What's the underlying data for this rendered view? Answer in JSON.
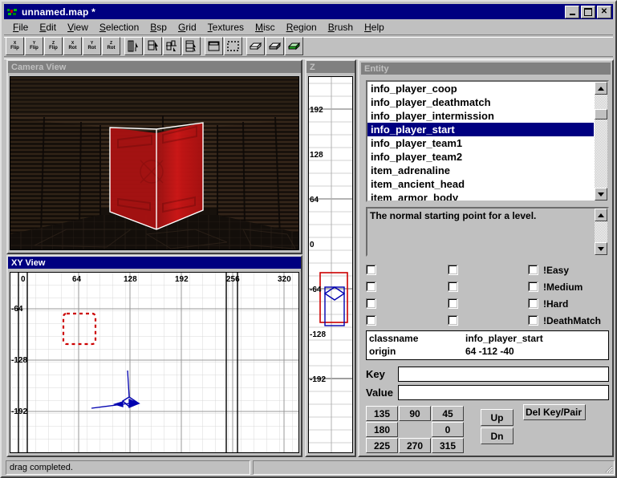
{
  "window": {
    "title": "unnamed.map *",
    "icon": "qe-app-icon",
    "buttons": {
      "minimize": "_",
      "maximize": "□",
      "close": "✕"
    }
  },
  "menu": [
    {
      "label": "File",
      "mnemonic": "F"
    },
    {
      "label": "Edit",
      "mnemonic": "E"
    },
    {
      "label": "View",
      "mnemonic": "V"
    },
    {
      "label": "Selection",
      "mnemonic": "S"
    },
    {
      "label": "Bsp",
      "mnemonic": "B"
    },
    {
      "label": "Grid",
      "mnemonic": "G"
    },
    {
      "label": "Textures",
      "mnemonic": "T"
    },
    {
      "label": "Misc",
      "mnemonic": "M"
    },
    {
      "label": "Region",
      "mnemonic": "R"
    },
    {
      "label": "Brush",
      "mnemonic": "B"
    },
    {
      "label": "Help",
      "mnemonic": "H"
    }
  ],
  "toolbar": [
    {
      "name": "flip-x-button",
      "sup": "X",
      "main": "Flip",
      "kind": "text"
    },
    {
      "name": "flip-y-button",
      "sup": "Y",
      "main": "Flip",
      "kind": "text"
    },
    {
      "name": "flip-z-button",
      "sup": "Z",
      "main": "Flip",
      "kind": "text"
    },
    {
      "name": "rotate-x-button",
      "sup": "X",
      "main": "Rot",
      "kind": "text"
    },
    {
      "name": "rotate-y-button",
      "sup": "Y",
      "main": "Rot",
      "kind": "text"
    },
    {
      "name": "rotate-z-button",
      "sup": "Z",
      "main": "Rot",
      "kind": "text"
    },
    {
      "name": "clip-selection-icon",
      "kind": "icon",
      "glyph": "clipper"
    },
    {
      "name": "split-selection-icon",
      "kind": "icon",
      "glyph": "splitter"
    },
    {
      "name": "flip-clip-icon",
      "kind": "icon",
      "glyph": "flipclip"
    },
    {
      "name": "brush-clipper-icon",
      "kind": "icon",
      "glyph": "brushclip"
    },
    {
      "name": "connect-entities-icon",
      "kind": "icon",
      "glyph": "connect"
    },
    {
      "name": "select-marquee-icon",
      "kind": "icon",
      "glyph": "marquee"
    },
    {
      "name": "cubic-clip-icon",
      "kind": "icon",
      "glyph": "cube-white"
    },
    {
      "name": "cubic-clip-dark-icon",
      "kind": "icon",
      "glyph": "cube-gray"
    },
    {
      "name": "cubic-clip-green-icon",
      "kind": "icon",
      "glyph": "cube-green"
    }
  ],
  "camera_view": {
    "title": "Camera View",
    "active": false
  },
  "xy_view": {
    "title": "XY View",
    "active": true,
    "x_ticks": [
      "0",
      "64",
      "128",
      "192",
      "256",
      "320"
    ],
    "y_ticks": [
      "-64",
      "-128",
      "-192"
    ],
    "selection_box": {
      "style": "dashed",
      "color": "#cc0000"
    },
    "entity_marker": {
      "color": "#0000b0",
      "shape": "info_player_start-arrow"
    }
  },
  "z_view": {
    "title": "Z",
    "active": false,
    "ticks": [
      "192",
      "128",
      "64",
      "0",
      "-64",
      "-128",
      "-192"
    ],
    "selection_box_color": "#cc0000",
    "brush_color": "#0000b0"
  },
  "entity_panel": {
    "title": "Entity",
    "list": [
      "info_player_coop",
      "info_player_deathmatch",
      "info_player_intermission",
      "info_player_start",
      "info_player_team1",
      "info_player_team2",
      "item_adrenaline",
      "item_ancient_head",
      "item_armor_body"
    ],
    "selected": "info_player_start",
    "selected_index": 3,
    "description": "The normal starting point for a level.",
    "spawnflags": {
      "col1": [
        "",
        "",
        "",
        ""
      ],
      "col2": [
        "",
        "",
        "",
        ""
      ],
      "col3": [
        "!Easy",
        "!Medium",
        "!Hard",
        "!DeathMatch"
      ]
    },
    "keyvalues": [
      {
        "key": "classname",
        "value": "info_player_start"
      },
      {
        "key": "origin",
        "value": "64 -112 -40"
      }
    ],
    "key_label": "Key",
    "value_label": "Value",
    "key_input": "",
    "value_input": "",
    "angles": [
      [
        "135",
        "90",
        "45"
      ],
      [
        "180",
        "",
        "0"
      ],
      [
        "225",
        "270",
        "315"
      ]
    ],
    "up_label": "Up",
    "dn_label": "Dn",
    "del_key_label": "Del Key/Pair"
  },
  "statusbar": {
    "message": "drag completed.",
    "right": ""
  },
  "colors": {
    "face": "#c0c0c0",
    "title_active": "#000080",
    "title_inactive": "#808080",
    "selection_red": "#cc0000",
    "brush_blue": "#0000b0",
    "highlight": "#000080"
  }
}
